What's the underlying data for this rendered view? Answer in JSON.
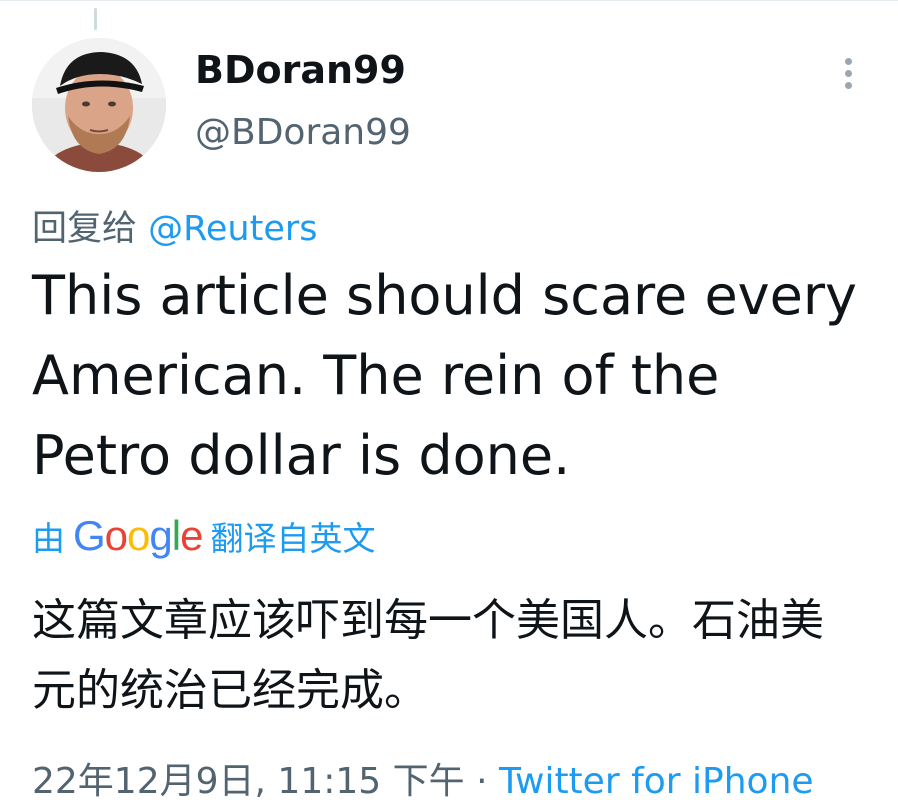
{
  "tweet": {
    "display_name": "BDoran99",
    "handle": "@BDoran99",
    "reply_prefix": "回复给",
    "reply_to": "@Reuters",
    "text": "This article should scare every American. The rein of the Petro dollar is done.",
    "translation": {
      "prefix": "由",
      "provider_letters": [
        "G",
        "o",
        "o",
        "g",
        "l",
        "e"
      ],
      "suffix": "翻译自英文",
      "text": "这篇文章应该吓到每一个美国人。石油美元的统治已经完成。"
    },
    "timestamp": "22年12月9日, 11:15 下午",
    "separator": "·",
    "source": "Twitter for iPhone"
  },
  "icons": {
    "more": "more-vertical-icon",
    "avatar": "user-avatar"
  },
  "colors": {
    "link": "#1d9bf0",
    "secondary_text": "#536471",
    "primary_text": "#0f1419"
  }
}
